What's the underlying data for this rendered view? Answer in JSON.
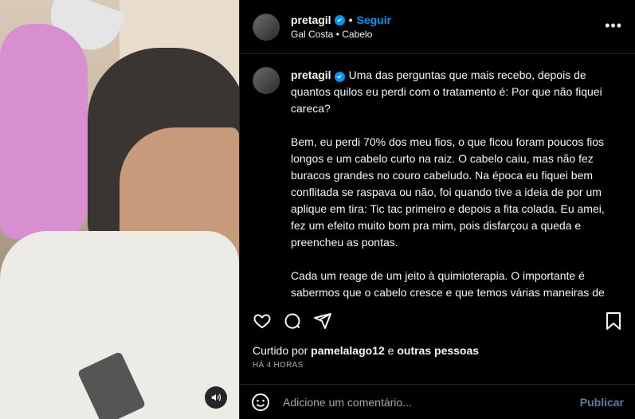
{
  "post": {
    "username": "pretagil",
    "follow_label": "Seguir",
    "separator": "•",
    "subtitle": "Gal Costa • Cabelo",
    "more": "•••"
  },
  "caption": {
    "username": "pretagil",
    "text": "Uma das perguntas que mais recebo, depois de quantos quilos eu perdi com o tratamento é: Por que não fiquei careca?\n\nBem, eu perdi 70% dos meu fios, o que ficou foram poucos fios longos e um cabelo curto na raiz. O cabelo caiu, mas não fez buracos grandes no couro cabeludo. Na época eu fiquei bem conflitada se raspava ou não, foi quando tive a ideia de por um aplique em tira: Tic tac primeiro e depois a fita colada. Eu amei, fez um efeito muito bom pra mim, pois disfarçou a queda e preencheu as pontas.\n\nCada um reage de um jeito à quimioterapia. O importante é sabermos que o cabelo cresce e que temos várias maneiras de resolver essa questão provisoriamente, seja com lenços, perucas, apliques ou também assumir a carequinha mesmo!!! #curapreta"
  },
  "likes": {
    "prefix": "Curtido por",
    "user": "pamelalago12",
    "joiner": "e",
    "others": "outras pessoas"
  },
  "timestamp": "HÁ 4 HORAS",
  "comment": {
    "placeholder": "Adicione um comentário...",
    "publish_label": "Publicar"
  },
  "icons": [
    "heart-icon",
    "comment-icon",
    "share-icon",
    "bookmark-icon",
    "emoji-icon",
    "sound-icon",
    "verified-icon"
  ],
  "colors": {
    "accent": "#0095f6",
    "background": "#000000",
    "muted": "#a8a8a8"
  }
}
